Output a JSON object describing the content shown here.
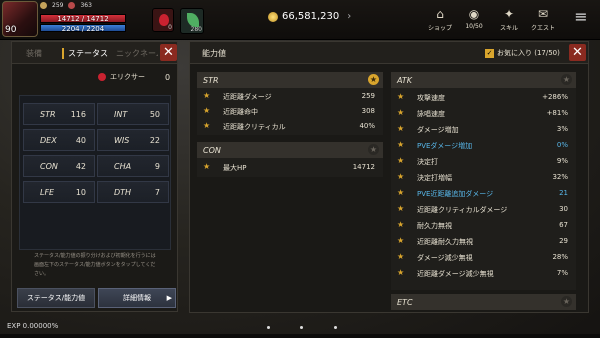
{
  "hud": {
    "level": "90",
    "hp": "14712 / 14712",
    "mp": "2204 / 2204",
    "buffs": [
      "259",
      "363"
    ],
    "potion_count": "0",
    "item_count": "280",
    "gold": "66,581,230",
    "buttons": [
      {
        "label": "ショップ",
        "icon": "shop-icon"
      },
      {
        "label": "10/50",
        "icon": "bag-icon"
      },
      {
        "label": "スキル",
        "icon": "skill-icon"
      },
      {
        "label": "クエスト",
        "icon": "quest-icon"
      }
    ]
  },
  "left": {
    "tabs": [
      "装備",
      "ステータス",
      "ニックネーム"
    ],
    "elixir_label": "エリクサー",
    "elixir_count": "0",
    "stats": [
      {
        "k": "STR",
        "v": "116"
      },
      {
        "k": "INT",
        "v": "50"
      },
      {
        "k": "DEX",
        "v": "40"
      },
      {
        "k": "WIS",
        "v": "22"
      },
      {
        "k": "CON",
        "v": "42"
      },
      {
        "k": "CHA",
        "v": "9"
      },
      {
        "k": "LFE",
        "v": "10"
      },
      {
        "k": "DTH",
        "v": "7"
      }
    ],
    "note": "ステータス/能力値の振り分けおよび初期化を行うには画面左下のステータス/能力値ボタンをタップしてください。",
    "btn_status": "ステータス/能力値",
    "btn_detail": "詳細情報"
  },
  "right": {
    "title": "能力値",
    "favorites": "お気に入り (17/50)",
    "str": {
      "head": "STR",
      "rows": [
        {
          "n": "近距離ダメージ",
          "v": "259"
        },
        {
          "n": "近距離命中",
          "v": "308"
        },
        {
          "n": "近距離クリティカル",
          "v": "40%"
        }
      ]
    },
    "con": {
      "head": "CON",
      "rows": [
        {
          "n": "最大HP",
          "v": "14712"
        }
      ]
    },
    "atk": {
      "head": "ATK",
      "rows": [
        {
          "n": "攻撃速度",
          "v": "+286%"
        },
        {
          "n": "詠唱速度",
          "v": "+81%"
        },
        {
          "n": "ダメージ増加",
          "v": "3%"
        },
        {
          "n": "PVEダメージ増加",
          "v": "0%",
          "blue": true
        },
        {
          "n": "決定打",
          "v": "9%"
        },
        {
          "n": "決定打増幅",
          "v": "32%"
        },
        {
          "n": "PVE近距離追加ダメージ",
          "v": "21",
          "blue": true
        },
        {
          "n": "近距離クリティカルダメージ",
          "v": "30"
        },
        {
          "n": "耐久力無視",
          "v": "67"
        },
        {
          "n": "近距離耐久力無視",
          "v": "29"
        },
        {
          "n": "ダメージ減少無視",
          "v": "28%"
        },
        {
          "n": "近距離ダメージ減少無視",
          "v": "7%"
        }
      ]
    },
    "etc": {
      "head": "ETC"
    }
  },
  "exp": "EXP 0.00000%",
  "colors": {
    "accent": "#d9a52d",
    "close": "#8a2a20",
    "blue": "#58b7ea"
  }
}
